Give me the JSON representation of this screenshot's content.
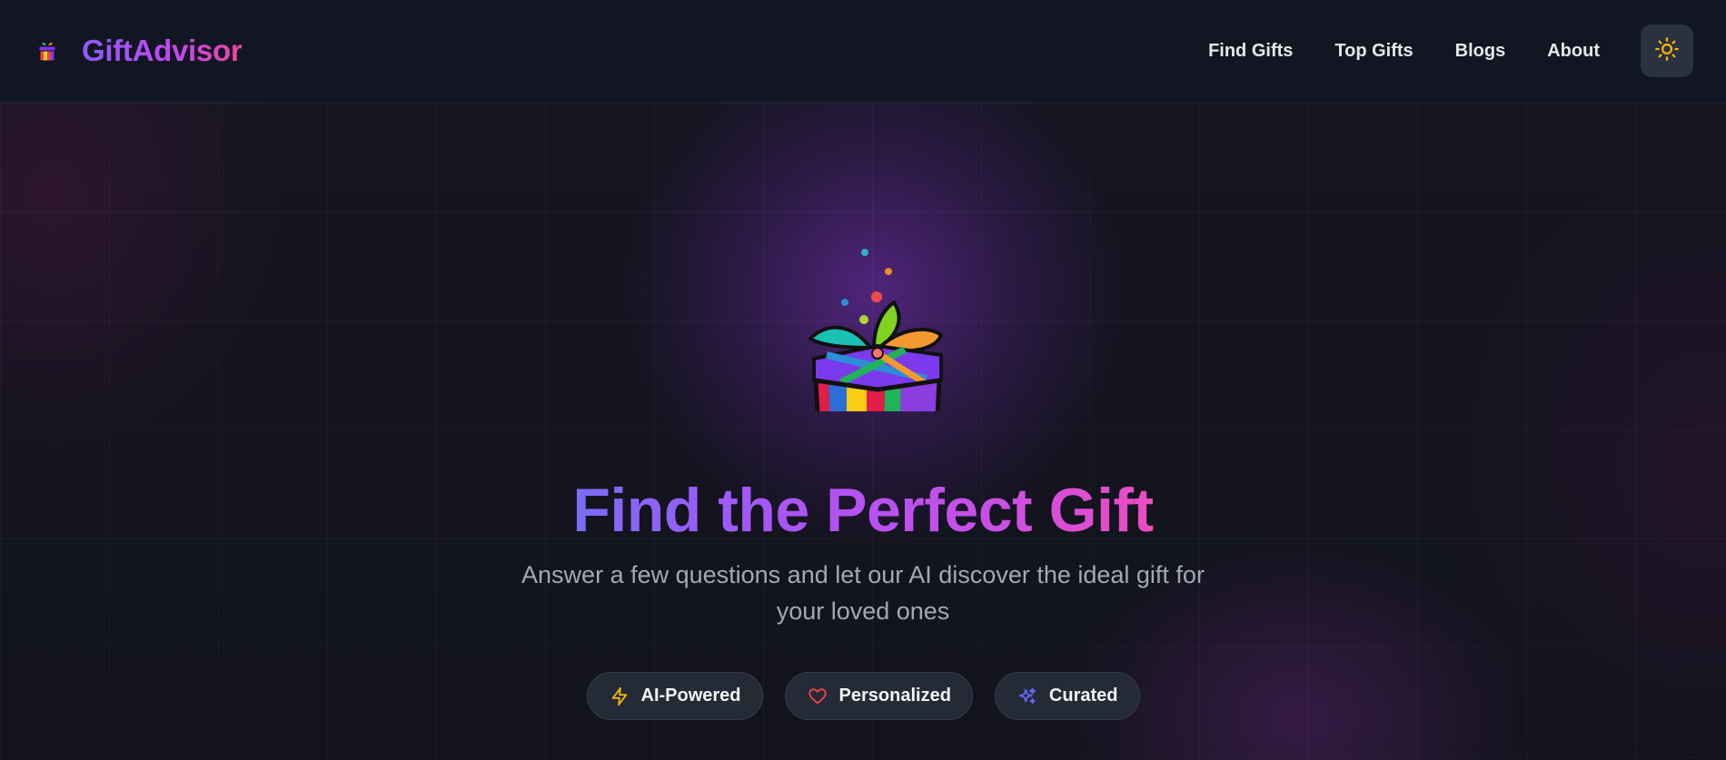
{
  "header": {
    "brand_name": "GiftAdvisor",
    "brand_icon": "gift-icon",
    "nav": [
      {
        "label": "Find Gifts"
      },
      {
        "label": "Top Gifts"
      },
      {
        "label": "Blogs"
      },
      {
        "label": "About"
      }
    ],
    "theme_toggle_icon": "sun-icon"
  },
  "hero": {
    "illustration": "gift-box-illustration",
    "title": "Find the Perfect Gift",
    "subtitle": "Answer a few questions and let our AI discover the ideal gift for your loved ones",
    "badges": [
      {
        "label": "AI-Powered",
        "icon": "lightning-icon",
        "color": "#f5b40a"
      },
      {
        "label": "Personalized",
        "icon": "heart-icon",
        "color": "#ef4444"
      },
      {
        "label": "Curated",
        "icon": "sparkles-icon",
        "color": "#6366f1"
      }
    ]
  },
  "colors": {
    "brand_gradient_start": "#8b5cf6",
    "brand_gradient_end": "#ec4899",
    "background": "#0f111a",
    "header_bg": "#121623"
  }
}
